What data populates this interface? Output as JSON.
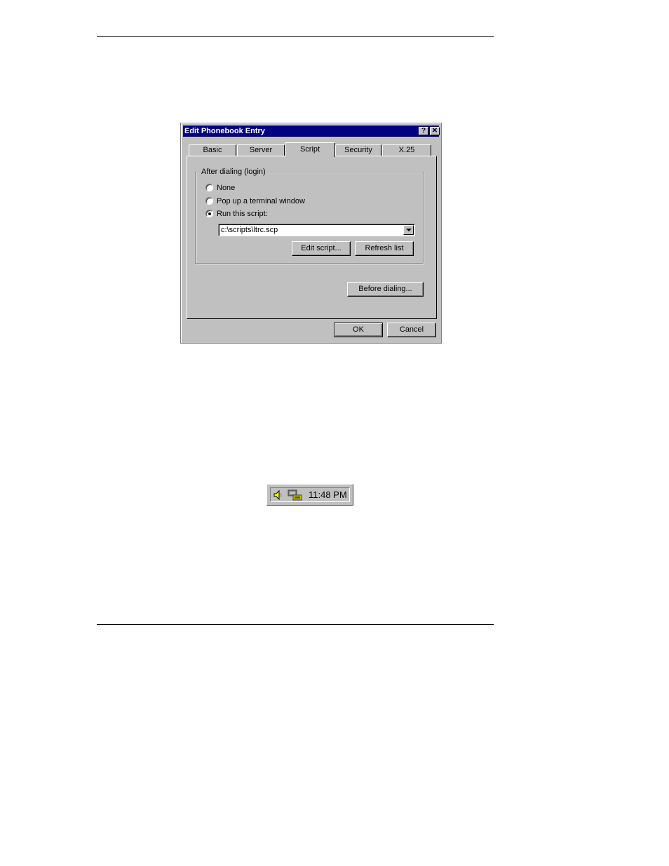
{
  "dialog": {
    "title": "Edit Phonebook Entry",
    "help_button": "?",
    "close_button": "✕",
    "tabs": [
      {
        "label": "Basic"
      },
      {
        "label": "Server"
      },
      {
        "label": "Script"
      },
      {
        "label": "Security"
      },
      {
        "label": "X.25"
      }
    ],
    "active_tab": "Script",
    "group_title": "After dialing (login)",
    "options": [
      {
        "label": "None",
        "checked": false
      },
      {
        "label": "Pop up a terminal window",
        "checked": false
      },
      {
        "label": "Run this script:",
        "checked": true
      }
    ],
    "script_path": "c:\\scripts\\ltrc.scp",
    "edit_script_button": "Edit script...",
    "refresh_list_button": "Refresh list",
    "before_dialing_button": "Before dialing...",
    "ok_button": "OK",
    "cancel_button": "Cancel"
  },
  "tray": {
    "clock": "11:48 PM",
    "icons": [
      "speaker-icon",
      "dialup-connection-icon"
    ]
  }
}
